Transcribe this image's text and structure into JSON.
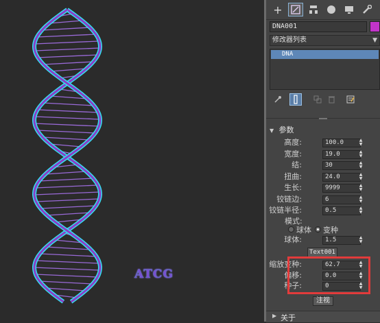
{
  "viewport": {
    "label_3d": "ATCG"
  },
  "command_panel": {
    "tabs": [
      "create-tab",
      "modify-tab",
      "hierarchy-tab",
      "motion-tab",
      "display-tab",
      "utilities-tab"
    ],
    "object_name": "DNA001",
    "object_color": "#c234c9",
    "modifier_list_label": "修改器列表",
    "stack": [
      "DNA"
    ],
    "rollout_params_title": "参数",
    "params": [
      {
        "label": "高度:",
        "value": "100.0"
      },
      {
        "label": "宽度:",
        "value": "19.0"
      },
      {
        "label": "结:",
        "value": "30"
      },
      {
        "label": "扭曲:",
        "value": "24.0"
      },
      {
        "label": "生长:",
        "value": "9999"
      },
      {
        "label": "铰链边:",
        "value": "6"
      },
      {
        "label": "铰链半径:",
        "value": "0.5"
      }
    ],
    "mode_label": "模式:",
    "mode_options": [
      "球体",
      "变种"
    ],
    "mode_selected": "变种",
    "sphere_label": "球体:",
    "sphere_value": "1.5",
    "text_button": "Text001",
    "highlighted_params": [
      {
        "label": "缩放变种:",
        "value": "62.7"
      },
      {
        "label": "偏移:",
        "value": "0.0"
      },
      {
        "label": "种子:",
        "value": "0"
      }
    ],
    "register_button": "注视",
    "rollout_about_title": "关于",
    "highlight_color": "#e23b3b"
  }
}
